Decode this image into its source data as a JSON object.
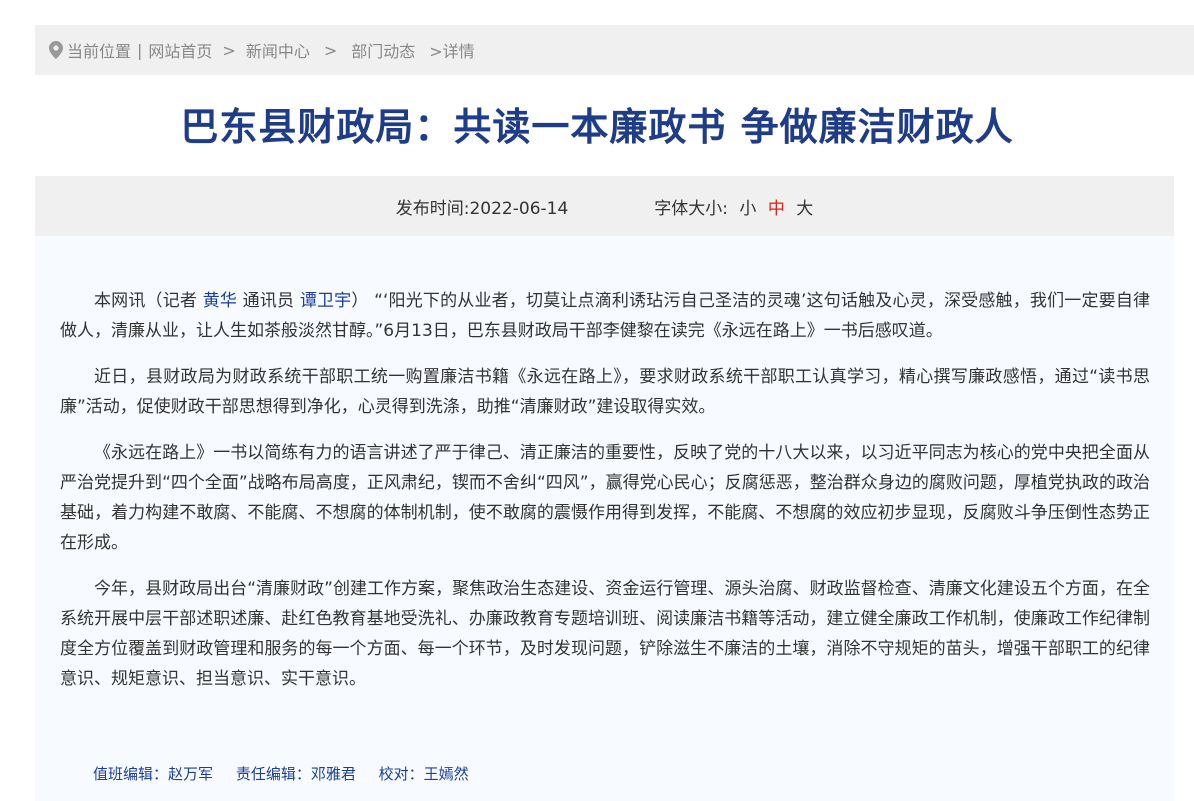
{
  "breadcrumb": {
    "current_label": "当前位置",
    "divider": "|",
    "home": "网站首页",
    "sep1": ">",
    "news": "新闻中心",
    "sep2": ">",
    "dept": "部门动态",
    "detail": ">详情"
  },
  "article": {
    "title": "巴东县财政局：共读一本廉政书 争做廉洁财政人",
    "publish_label": "发布时间:",
    "publish_date": "2022-06-14",
    "font_size_label": "字体大小:",
    "font_small": "小",
    "font_medium": "中",
    "font_large": "大",
    "p1_a": "本网讯（记者 ",
    "p1_reporter": "黄华",
    "p1_b": " 通讯员 ",
    "p1_correspondent": "谭卫宇",
    "p1_c": "） “‘阳光下的从业者，切莫让点滴利诱玷污自己圣洁的灵魂’这句话触及心灵，深受感触，我们一定要自律做人，清廉从业，让人生如茶般淡然甘醇。”6月13日，巴东县财政局干部李健黎在读完《永远在路上》一书后感叹道。",
    "p2": "近日，县财政局为财政系统干部职工统一购置廉洁书籍《永远在路上》，要求财政系统干部职工认真学习，精心撰写廉政感悟，通过“读书思廉”活动，促使财政干部思想得到净化，心灵得到洗涤，助推“清廉财政”建设取得实效。",
    "p3": "《永远在路上》一书以简练有力的语言讲述了严于律己、清正廉洁的重要性，反映了党的十八大以来，以习近平同志为核心的党中央把全面从严治党提升到“四个全面”战略布局高度，正风肃纪，锲而不舍纠“四风”，赢得党心民心；反腐惩恶，整治群众身边的腐败问题，厚植党执政的政治基础，着力构建不敢腐、不能腐、不想腐的体制机制，使不敢腐的震慑作用得到发挥，不能腐、不想腐的效应初步显现，反腐败斗争压倒性态势正在形成。",
    "p4": "今年，县财政局出台“清廉财政”创建工作方案，聚焦政治生态建设、资金运行管理、源头治腐、财政监督检查、清廉文化建设五个方面，在全系统开展中层干部述职述廉、赴红色教育基地受洗礼、办廉政教育专题培训班、阅读廉洁书籍等活动，建立健全廉政工作机制，使廉政工作纪律制度全方位覆盖到财政管理和服务的每一个方面、每一个环节，及时发现问题，铲除滋生不廉洁的土壤，消除不守规矩的苗头，增强干部职工的纪律意识、规矩意识、担当意识、实干意识。"
  },
  "editors": {
    "duty_label": "值班编辑：",
    "duty_name": "赵万军",
    "resp_label": "责任编辑：",
    "resp_name": "邓雅君",
    "proof_label": "校对：",
    "proof_name": "王嫣然"
  },
  "colors": {
    "title": "#1f3c88",
    "link": "#1a3ea0",
    "active_font": "#e0201a",
    "bar_bg": "#f0f0f0"
  },
  "icons": {
    "location": "location-pin-icon"
  }
}
